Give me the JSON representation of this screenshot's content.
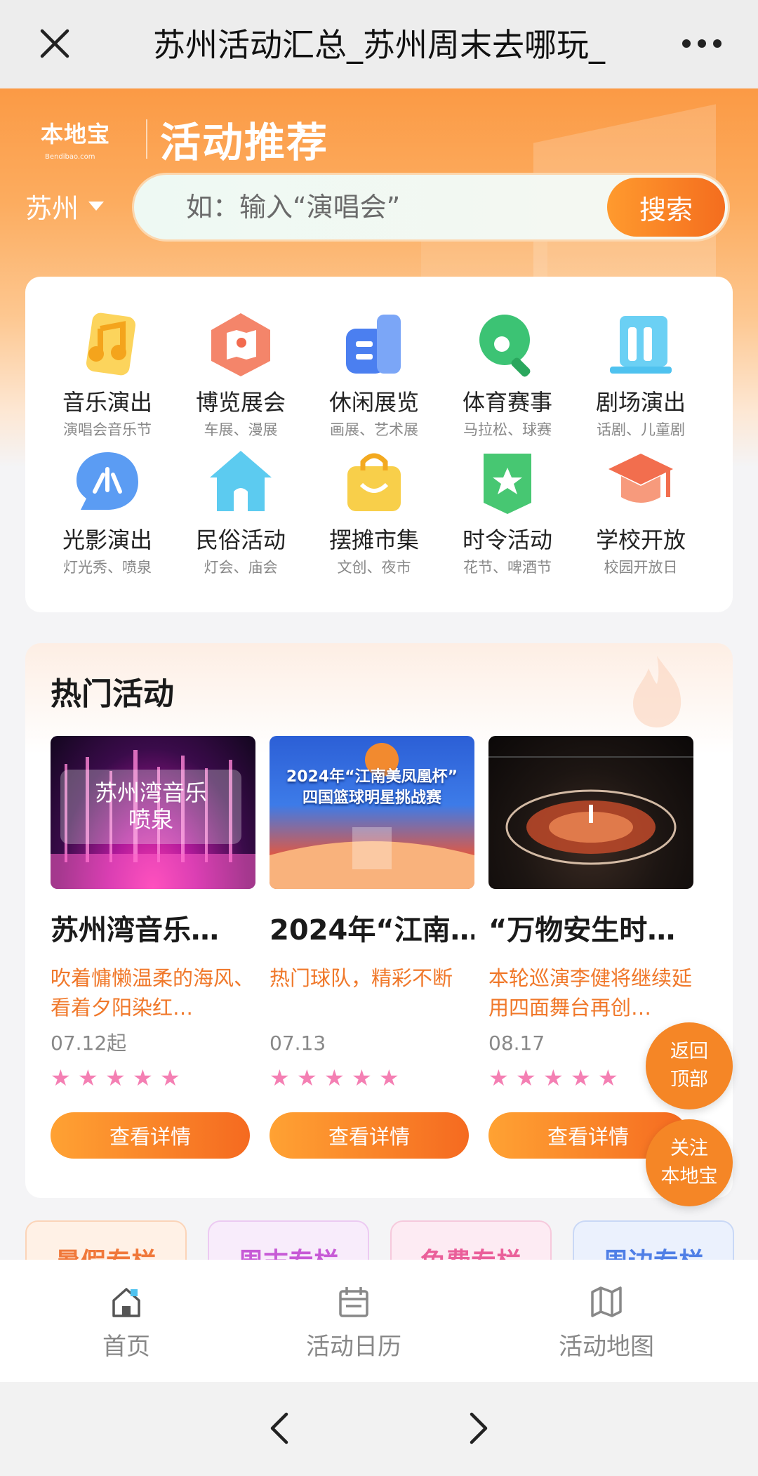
{
  "titlebar": {
    "title": "苏州活动汇总_苏州周末去哪玩_"
  },
  "hero": {
    "logo_cn": "本地宝",
    "logo_en": "Bendibao.com",
    "brand": "活动推荐",
    "city": "苏州",
    "search_placeholder": "如：输入“演唱会”",
    "search_button": "搜索"
  },
  "categories": [
    {
      "name": "音乐演出",
      "sub": "演唱会音乐节",
      "icon": "music-icon",
      "color": "#f7c12f"
    },
    {
      "name": "博览展会",
      "sub": "车展、漫展",
      "icon": "map-icon",
      "color": "#f26b4f"
    },
    {
      "name": "休闲展览",
      "sub": "画展、艺术展",
      "icon": "gallery-icon",
      "color": "#4b7ff0"
    },
    {
      "name": "体育赛事",
      "sub": "马拉松、球赛",
      "icon": "pingpong-icon",
      "color": "#3cc374"
    },
    {
      "name": "剧场演出",
      "sub": "话剧、儿童剧",
      "icon": "theater-icon",
      "color": "#4fc2ef"
    },
    {
      "name": "光影演出",
      "sub": "灯光秀、喷泉",
      "icon": "light-icon",
      "color": "#4a8ff0"
    },
    {
      "name": "民俗活动",
      "sub": "灯会、庙会",
      "icon": "house-icon",
      "color": "#47c3ea"
    },
    {
      "name": "摆摊市集",
      "sub": "文创、夜市",
      "icon": "shopping-bag-icon",
      "color": "#f6c532"
    },
    {
      "name": "时令活动",
      "sub": "花节、啤酒节",
      "icon": "star-badge-icon",
      "color": "#3fc16b"
    },
    {
      "name": "学校开放",
      "sub": "校园开放日",
      "icon": "graduation-cap-icon",
      "color": "#f26e4e"
    }
  ],
  "hot": {
    "title": "热门活动",
    "cards": [
      {
        "title": "苏州湾音乐…",
        "desc": "吹着慵懒温柔的海风、看着夕阳染红…",
        "date": "07.12起",
        "image_text": "苏州湾音乐\n喷泉",
        "rating": 5,
        "button": "查看详情"
      },
      {
        "title": "2024年“江南…",
        "desc": "热门球队，精彩不断",
        "date": "07.13",
        "image_text": "2024年“江南美凤凰杯”\n四国篮球明星挑战赛",
        "rating": 5,
        "button": "查看详情"
      },
      {
        "title": "“万物安生时…",
        "desc": "本轮巡演李健将继续延用四面舞台再创…",
        "date": "08.17",
        "image_text": "",
        "rating": 5,
        "button": "查看详情"
      }
    ]
  },
  "floating": {
    "back_top": "返回\n顶部",
    "follow": "关注\n本地宝"
  },
  "columns": [
    {
      "label": "暑假专栏",
      "color": "#f0783a",
      "bg": "#fff1e6"
    },
    {
      "label": "周末专栏",
      "color": "#c75ad6",
      "bg": "#f8ecfb"
    },
    {
      "label": "免费专栏",
      "color": "#ea5f9a",
      "bg": "#fdebf3"
    },
    {
      "label": "周边专栏",
      "color": "#4f7fe6",
      "bg": "#ebf1fd"
    }
  ],
  "tabs": [
    {
      "label": "首页",
      "icon": "home-icon"
    },
    {
      "label": "活动日历",
      "icon": "calendar-icon"
    },
    {
      "label": "活动地图",
      "icon": "map-icon"
    }
  ]
}
